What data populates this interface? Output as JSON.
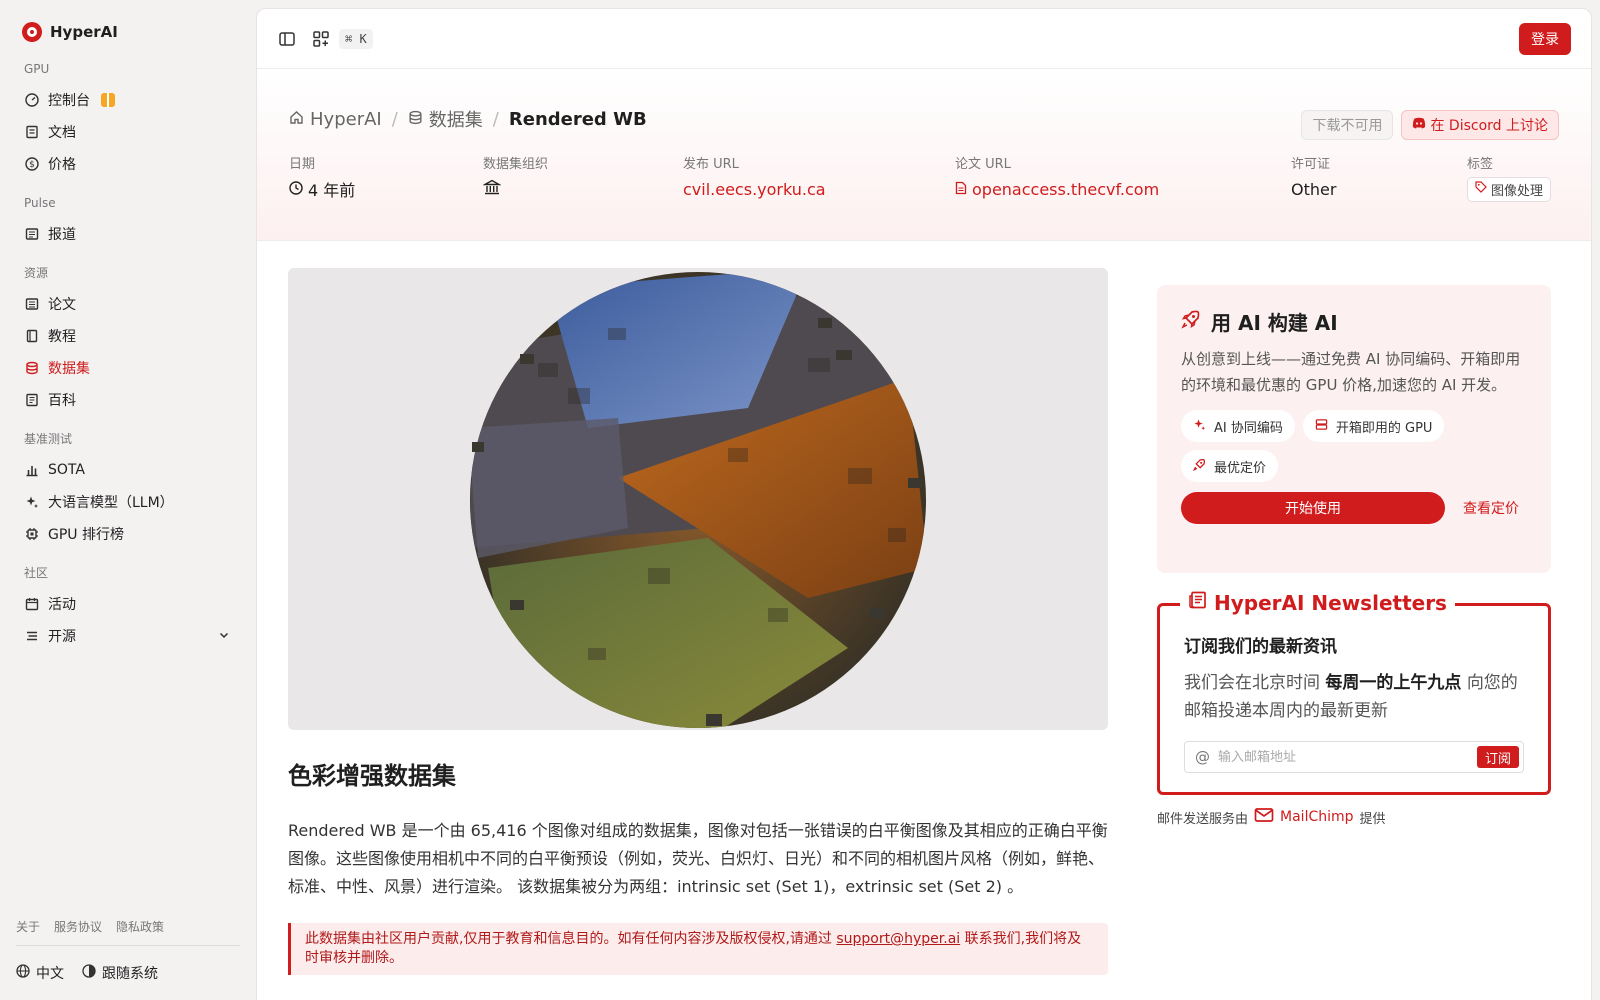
{
  "sidebar": {
    "brand": "HyperAI",
    "sections": [
      {
        "title": "GPU"
      },
      {
        "title": "Pulse"
      },
      {
        "title": "资源"
      },
      {
        "title": "基准测试"
      },
      {
        "title": "社区"
      }
    ],
    "items": {
      "console": "控制台",
      "docs": "文档",
      "pricing": "价格",
      "reports": "报道",
      "papers": "论文",
      "tutorials": "教程",
      "datasets": "数据集",
      "wiki": "百科",
      "sota": "SOTA",
      "llm": "大语言模型（LLM）",
      "gpu_rank": "GPU 排行榜",
      "events": "活动",
      "opensource": "开源"
    },
    "footer_links": [
      "关于",
      "服务协议",
      "隐私政策"
    ],
    "language": "中文",
    "theme": "跟随系统"
  },
  "topbar": {
    "shortcut": "⌘ K",
    "login": "登录"
  },
  "header": {
    "breadcrumb": [
      "HyperAI",
      "数据集",
      "Rendered WB"
    ],
    "download_label": "下载不可用",
    "discord_label": "在 Discord 上讨论",
    "meta": {
      "date_label": "日期",
      "date_value": "4 年前",
      "org_label": "数据集组织",
      "url_label": "发布 URL",
      "url_value": "cvil.eecs.yorku.ca",
      "paper_label": "论文 URL",
      "paper_value": "openaccess.thecvf.com",
      "license_label": "许可证",
      "license_value": "Other",
      "tags_label": "标签",
      "tag_value": "图像处理"
    }
  },
  "content": {
    "title": "色彩增强数据集",
    "description": "Rendered WB 是一个由 65,416 个图像对组成的数据集，图像对包括一张错误的白平衡图像及其相应的正确白平衡图像。这些图像使用相机中不同的白平衡预设（例如，荧光、白炽灯、日光）和不同的相机图片风格（例如，鲜艳、标准、中性、风景）进行渲染。 该数据集被分为两组：intrinsic set (Set 1)，extrinsic set (Set 2) 。",
    "notice_pre": "此数据集由社区用户贡献,仅用于教育和信息目的。如有任何内容涉及版权侵权,请通过",
    "notice_email": "support@hyper.ai",
    "notice_post": "联系我们,我们将及时审核并删除。"
  },
  "promo": {
    "title": "用 AI 构建 AI",
    "text": "从创意到上线——通过免费 AI 协同编码、开箱即用的环境和最优惠的 GPU 价格,加速您的 AI 开发。",
    "chips": [
      "AI 协同编码",
      "开箱即用的 GPU",
      "最优定价"
    ],
    "start": "开始使用",
    "pricing": "查看定价"
  },
  "newsletter": {
    "legend": "HyperAI Newsletters",
    "heading": "订阅我们的最新资讯",
    "text_pre": "我们会在北京时间",
    "text_bold": "每周一的上午九点",
    "text_post": "向您的邮箱投递本周内的最新更新",
    "placeholder": "输入邮箱地址",
    "subscribe": "订阅",
    "provider_pre": "邮件发送服务由",
    "provider": "MailChimp",
    "provider_post": "提供"
  },
  "colors": {
    "accent": "#d01c1c",
    "sidebar_bg": "#f4f1f1",
    "promo_bg": "#fdf0f0"
  }
}
